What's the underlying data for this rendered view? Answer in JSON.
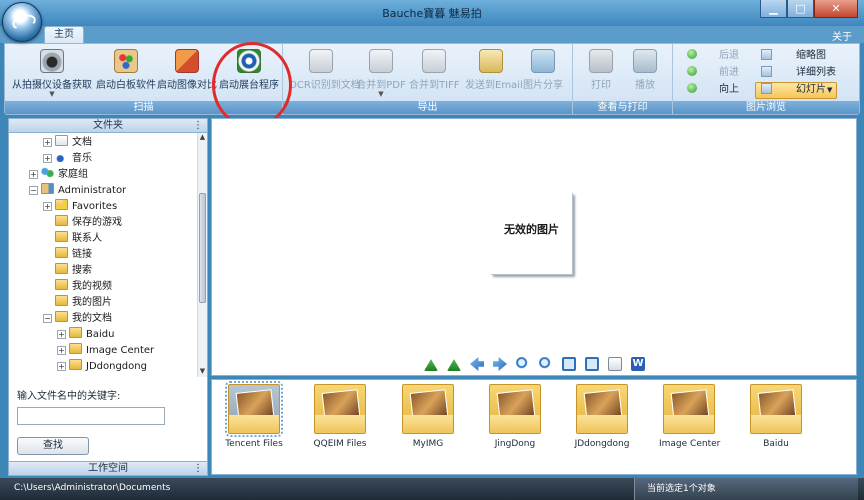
{
  "window": {
    "title": "Bauche寶暮 魅易拍"
  },
  "tabs": [
    {
      "label": "主页"
    }
  ],
  "about_label": "关于",
  "ribbon": {
    "groups": {
      "scan": {
        "label": "扫描",
        "buttons": [
          {
            "label": "从拍摄仪设备获取",
            "icon": "camera-icon"
          },
          {
            "label": "启动白板软件",
            "icon": "palette-icon"
          },
          {
            "label": "启动图像对比",
            "icon": "compare-icon"
          },
          {
            "label": "启动展台程序",
            "icon": "presenter-icon"
          }
        ]
      },
      "export": {
        "label": "导出",
        "buttons": [
          {
            "label": "OCR识别到文档",
            "icon": "ocr-icon"
          },
          {
            "label": "合并到PDF",
            "icon": "pdf-icon"
          },
          {
            "label": "合并到TIFF",
            "icon": "tiff-icon"
          },
          {
            "label": "发送到Email",
            "icon": "email-icon"
          },
          {
            "label": "图片分享",
            "icon": "share-icon"
          }
        ]
      },
      "view_print": {
        "label": "查看与打印",
        "buttons": [
          {
            "label": "打印",
            "icon": "print-icon"
          },
          {
            "label": "播放",
            "icon": "play-icon"
          }
        ]
      },
      "browse": {
        "label": "图片浏览",
        "nav": [
          {
            "label": "后退"
          },
          {
            "label": "前进"
          },
          {
            "label": "向上"
          }
        ],
        "views": [
          {
            "label": "缩略图"
          },
          {
            "label": "详细列表"
          },
          {
            "label": "幻灯片"
          }
        ]
      }
    }
  },
  "left_panel": {
    "header": "文件夹",
    "grip": "⋮",
    "tree": [
      {
        "label": "文档",
        "icon": "document-icon"
      },
      {
        "label": "音乐",
        "icon": "music-icon"
      },
      {
        "label": "家庭组",
        "icon": "homegroup-icon"
      },
      {
        "label": "Administrator",
        "icon": "user-folder-icon"
      },
      {
        "label": "Favorites",
        "icon": "favorites-icon"
      },
      {
        "label": "保存的游戏",
        "icon": "folder-icon"
      },
      {
        "label": "联系人",
        "icon": "contacts-icon"
      },
      {
        "label": "链接",
        "icon": "links-icon"
      },
      {
        "label": "搜索",
        "icon": "search-folder-icon"
      },
      {
        "label": "我的视频",
        "icon": "videos-icon"
      },
      {
        "label": "我的图片",
        "icon": "pictures-icon"
      },
      {
        "label": "我的文档",
        "icon": "documents-icon"
      },
      {
        "label": "Baidu",
        "icon": "folder-icon"
      },
      {
        "label": "Image Center",
        "icon": "folder-icon"
      },
      {
        "label": "JDdongdong",
        "icon": "folder-icon"
      }
    ],
    "keyword_label": "输入文件名中的关键字:",
    "keyword_value": "",
    "find_label": "查找",
    "workspace_label": "工作空间"
  },
  "viewer": {
    "message": "无效的图片"
  },
  "thumbnails": [
    {
      "label": "Tencent Files",
      "selected": true
    },
    {
      "label": "QQEIM Files",
      "selected": false
    },
    {
      "label": "MyIMG",
      "selected": false
    },
    {
      "label": "JingDong",
      "selected": false
    },
    {
      "label": "JDdongdong",
      "selected": false
    },
    {
      "label": "Image Center",
      "selected": false
    },
    {
      "label": "Baidu",
      "selected": false
    }
  ],
  "status": {
    "path": "C:\\Users\\Administrator\\Documents",
    "selection": "当前选定1个对象"
  },
  "colors": {
    "annotation_ring": "#e02b2b",
    "accent": "#3c86b8"
  }
}
